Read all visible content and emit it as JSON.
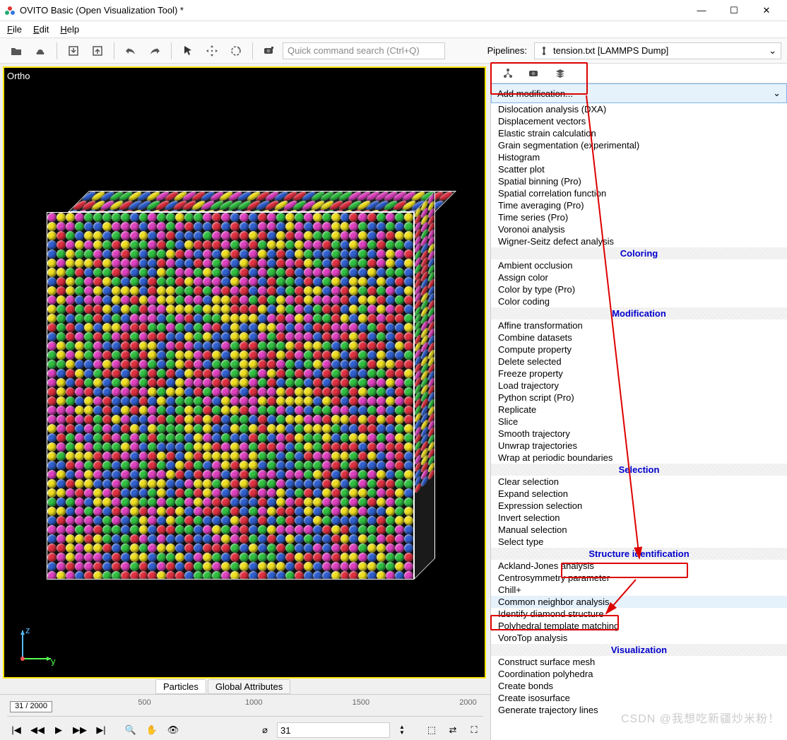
{
  "window": {
    "title": "OVITO Basic (Open Visualization Tool) *"
  },
  "menu": {
    "file": "File",
    "edit": "Edit",
    "help": "Help"
  },
  "toolbar": {
    "quick_placeholder": "Quick command search (Ctrl+Q)",
    "pipelines_label": "Pipelines:",
    "pipeline_selected": "tension.txt [LAMMPS Dump]"
  },
  "viewport": {
    "projection": "Ortho",
    "axis_z": "z",
    "axis_y": "y"
  },
  "tabs": {
    "particles": "Particles",
    "global": "Global Attributes"
  },
  "timeline": {
    "handle": "31 / 2000",
    "ticks": [
      "500",
      "1000",
      "1500",
      "2000"
    ],
    "frame_value": "31"
  },
  "right": {
    "add_mod": "Add modification...",
    "groups": [
      {
        "header": null,
        "items": [
          "Dislocation analysis (DXA)",
          "Displacement vectors",
          "Elastic strain calculation",
          "Grain segmentation (experimental)",
          "Histogram",
          "Scatter plot",
          "Spatial binning (Pro)",
          "Spatial correlation function",
          "Time averaging (Pro)",
          "Time series (Pro)",
          "Voronoi analysis",
          "Wigner-Seitz defect analysis"
        ]
      },
      {
        "header": "Coloring",
        "items": [
          "Ambient occlusion",
          "Assign color",
          "Color by type (Pro)",
          "Color coding"
        ]
      },
      {
        "header": "Modification",
        "items": [
          "Affine transformation",
          "Combine datasets",
          "Compute property",
          "Delete selected",
          "Freeze property",
          "Load trajectory",
          "Python script (Pro)",
          "Replicate",
          "Slice",
          "Smooth trajectory",
          "Unwrap trajectories",
          "Wrap at periodic boundaries"
        ]
      },
      {
        "header": "Selection",
        "items": [
          "Clear selection",
          "Expand selection",
          "Expression selection",
          "Invert selection",
          "Manual selection",
          "Select type"
        ]
      },
      {
        "header": "Structure identification",
        "items": [
          "Ackland-Jones analysis",
          "Centrosymmetry parameter",
          "Chill+",
          "Common neighbor analysis",
          "Identify diamond structure",
          "Polyhedral template matching",
          "VoroTop analysis"
        ]
      },
      {
        "header": "Visualization",
        "items": [
          "Construct surface mesh",
          "Coordination polyhedra",
          "Create bonds",
          "Create isosurface",
          "Generate trajectory lines"
        ]
      }
    ],
    "highlighted_item": "Common neighbor analysis"
  },
  "watermark": "CSDN @我想吃新疆炒米粉！",
  "atom_colors": [
    "#e03040",
    "#3060d0",
    "#f0e020",
    "#e040c0",
    "#30c040"
  ]
}
